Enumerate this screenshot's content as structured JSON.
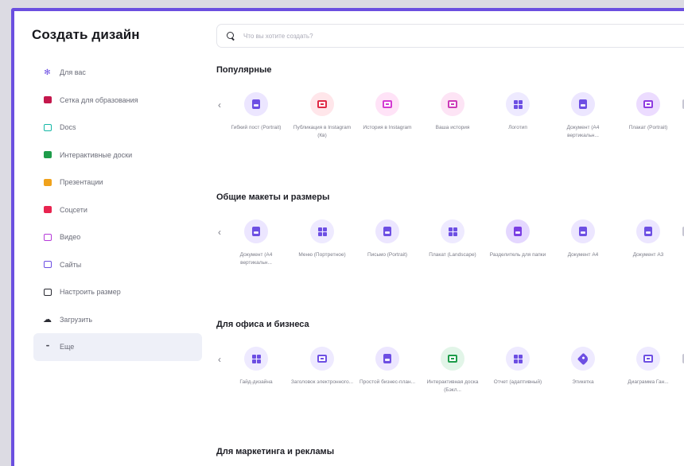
{
  "sidebar": {
    "title": "Создать дизайн",
    "items": [
      {
        "label": "Для вас",
        "icon": "sparkle-icon",
        "color": "#6d4fe3"
      },
      {
        "label": "Сетка для образования",
        "icon": "graduation-cap-icon",
        "color": "#c4174c"
      },
      {
        "label": "Docs",
        "icon": "docs-icon",
        "color": "#15b8a6"
      },
      {
        "label": "Интерактивные доски",
        "icon": "whiteboard-icon",
        "color": "#1e9c4a"
      },
      {
        "label": "Презентации",
        "icon": "presentation-icon",
        "color": "#f0a21c"
      },
      {
        "label": "Соцсети",
        "icon": "social-media-icon",
        "color": "#e8244f"
      },
      {
        "label": "Видео",
        "icon": "video-icon",
        "color": "#b63ad9"
      },
      {
        "label": "Сайты",
        "icon": "website-icon",
        "color": "#6d4fe3"
      },
      {
        "label": "Настроить размер",
        "icon": "custom-size-icon",
        "color": "#2a2b33"
      },
      {
        "label": "Загрузить",
        "icon": "upload-cloud-icon",
        "color": "#2a2b33"
      },
      {
        "label": "Еще",
        "icon": "more-icon",
        "color": "#4a4b56"
      }
    ]
  },
  "search": {
    "placeholder": "Что вы хотите создать?"
  },
  "sections": [
    {
      "title": "Популярные",
      "tiles": [
        {
          "label": "Гибкий пост (Portrait)",
          "icon": "sheet",
          "bg": "#ece6ff",
          "fg": "#6d4fe3"
        },
        {
          "label": "Публикация в Instagram (Кв)",
          "icon": "box",
          "bg": "#ffe6ea",
          "fg": "#e02a46"
        },
        {
          "label": "История в Instagram",
          "icon": "box",
          "bg": "#ffe3f7",
          "fg": "#d43bd2"
        },
        {
          "label": "Ваша история",
          "icon": "box",
          "bg": "#fde4f5",
          "fg": "#cc3bb8"
        },
        {
          "label": "Логотип",
          "icon": "grid",
          "bg": "#eeeaff",
          "fg": "#6d4fe3"
        },
        {
          "label": "Документ (A4 вертикальн...",
          "icon": "sheet",
          "bg": "#ece6ff",
          "fg": "#6d4fe3"
        },
        {
          "label": "Плакат (Portrait)",
          "icon": "box",
          "bg": "#ecdcff",
          "fg": "#8e3be0"
        }
      ]
    },
    {
      "title": "Общие макеты и размеры",
      "tiles": [
        {
          "label": "Документ (A4 вертикальн...",
          "icon": "sheet",
          "bg": "#ece6ff",
          "fg": "#6d4fe3"
        },
        {
          "label": "Меню (Портретное)",
          "icon": "grid",
          "bg": "#eeeaff",
          "fg": "#6d4fe3"
        },
        {
          "label": "Письмо (Portrait)",
          "icon": "sheet",
          "bg": "#ece6ff",
          "fg": "#6d4fe3"
        },
        {
          "label": "Плакат (Landscape)",
          "icon": "grid",
          "bg": "#eeeaff",
          "fg": "#6d4fe3"
        },
        {
          "label": "Разделитель для папки",
          "icon": "sheet",
          "bg": "#e4d7ff",
          "fg": "#7a3ee3"
        },
        {
          "label": "Документ A4",
          "icon": "sheet",
          "bg": "#ece6ff",
          "fg": "#6d4fe3"
        },
        {
          "label": "Документ A3",
          "icon": "sheet",
          "bg": "#ece6ff",
          "fg": "#6d4fe3"
        }
      ]
    },
    {
      "title": "Для офиса и бизнеса",
      "tiles": [
        {
          "label": "Гайд-дизайна",
          "icon": "grid",
          "bg": "#eeeaff",
          "fg": "#6d4fe3"
        },
        {
          "label": "Заголовок электронного...",
          "icon": "box",
          "bg": "#eeeaff",
          "fg": "#6d4fe3"
        },
        {
          "label": "Простой бизнес-план...",
          "icon": "sheet",
          "bg": "#ece6ff",
          "fg": "#6d4fe3"
        },
        {
          "label": "Интерактивная доска (Бэкл...",
          "icon": "box",
          "bg": "#e2f5e8",
          "fg": "#1e9c4a"
        },
        {
          "label": "Отчет (адаптивный)",
          "icon": "grid",
          "bg": "#eeeaff",
          "fg": "#6d4fe3"
        },
        {
          "label": "Этикетка",
          "icon": "tag",
          "bg": "#eeeaff",
          "fg": "#6d4fe3"
        },
        {
          "label": "Диаграмма Ган...",
          "icon": "box",
          "bg": "#eeeaff",
          "fg": "#6d4fe3"
        }
      ]
    },
    {
      "title": "Для маркетинга и рекламы",
      "tiles": []
    }
  ]
}
